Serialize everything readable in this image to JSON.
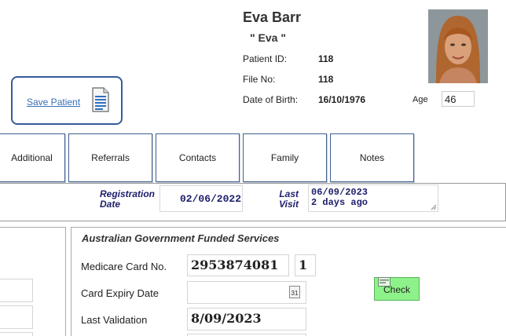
{
  "patient": {
    "name": "Eva Barr",
    "nickname": "\" Eva \"",
    "id_label": "Patient ID:",
    "id_value": "118",
    "file_label": "File No:",
    "file_value": "118",
    "dob_label": "Date of Birth:",
    "dob_value": "16/10/1976",
    "age_label": "Age",
    "age_value": "46",
    "photo_icon": "patient-photo"
  },
  "save": {
    "label": "Save Patient",
    "icon": "document-icon"
  },
  "tabs": [
    {
      "label": "Additional"
    },
    {
      "label": "Referrals"
    },
    {
      "label": "Contacts"
    },
    {
      "label": "Family"
    },
    {
      "label": "Notes"
    }
  ],
  "registration": {
    "reg_label_1": "Registration",
    "reg_label_2": "Date",
    "reg_value": "02/06/2022",
    "visit_label_1": "Last",
    "visit_label_2": "Visit",
    "visit_value_1": "06/09/2023",
    "visit_value_2": "2 days ago"
  },
  "medicare": {
    "title": "Australian Government Funded Services",
    "card_label": "Medicare Card No.",
    "card_value": "2953874081",
    "card_irn": "1",
    "expiry_label": "Card Expiry Date",
    "expiry_value": "",
    "calendar_icon": "calendar-icon",
    "calendar_text": "31",
    "validation_label": "Last Validation",
    "validation_value": "8/09/2023",
    "check_label": "Check"
  },
  "colors": {
    "tab_border": "#3f5f8f",
    "label_navy": "#1d1e6b",
    "check_green": "#8ef28a",
    "save_border": "#3a5a9c",
    "link_blue": "#3b6fb6"
  }
}
